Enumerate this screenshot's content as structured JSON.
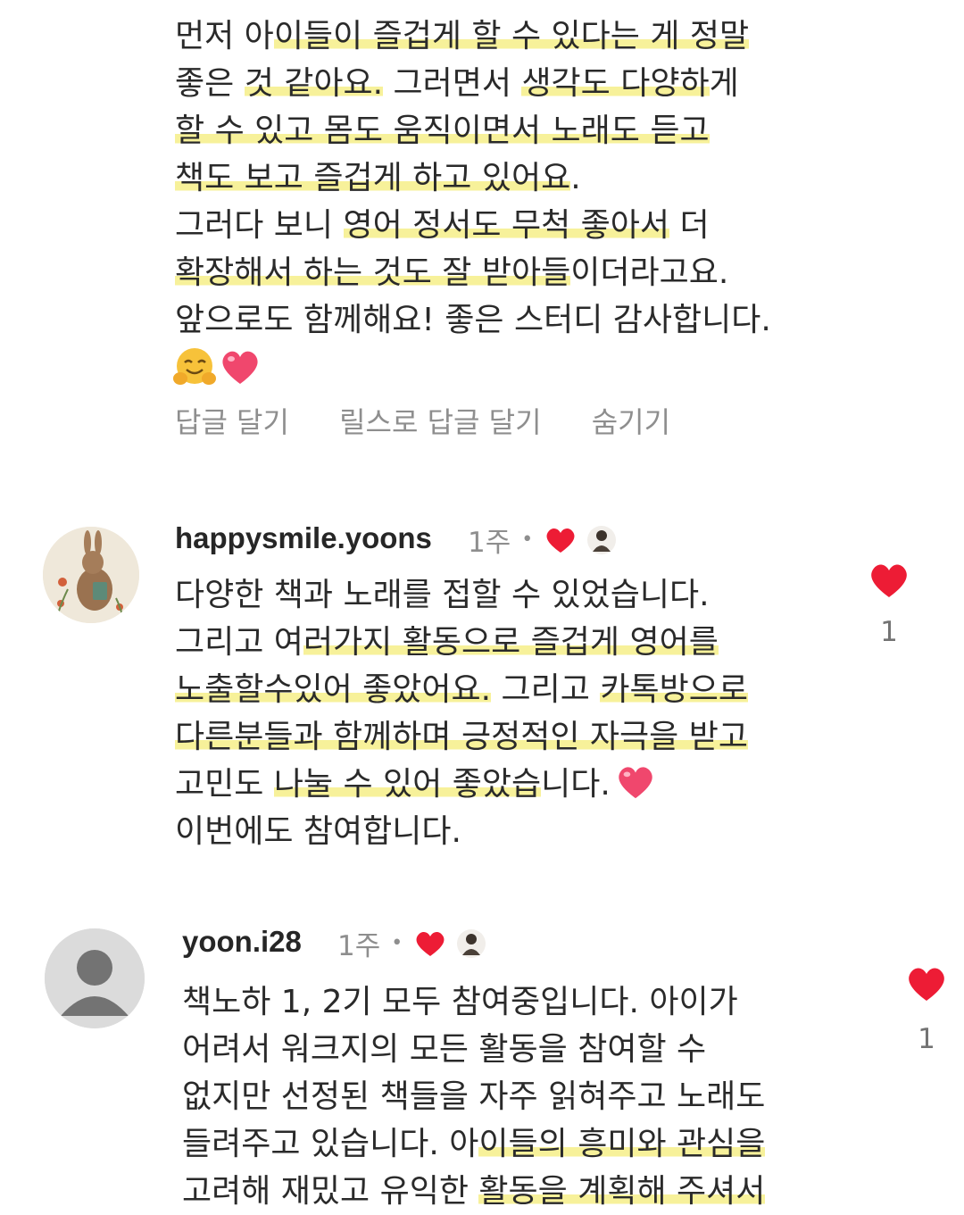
{
  "comment_prev": {
    "lines": [
      [
        "먼저 아",
        "이들이 즐겁게 할 수 있다는 게 정말",
        ""
      ],
      [
        "좋은 ",
        "것 같아요.",
        " 그러면서 ",
        "생각도 다양하",
        "게"
      ],
      [
        "",
        "할 수 있고 몸도 움직이면서 노래도 듣고",
        ""
      ],
      [
        "",
        "책도 보고 즐겁게 하고 있어요",
        "."
      ],
      [
        "그러다 보니 ",
        "영어 정서도 무척 좋아서",
        " 더"
      ],
      [
        "",
        "확장해서 하는 것도 잘 받아들",
        "이더라고요."
      ],
      [
        "앞으로도 함께해요! 좋은 스터디 감사합니다.",
        "",
        ""
      ]
    ],
    "actions": {
      "reply": "답글 달기",
      "reels_reply": "릴스로 답글 달기",
      "hide": "숨기기"
    }
  },
  "comment_1": {
    "username": "happysmile.yoons",
    "time": "1주",
    "like_count": "1",
    "lines": [
      [
        "다양한 책과 노래를 접할 수 있었습니다.",
        "",
        ""
      ],
      [
        "그리고 여",
        "러가지 활동으로 즐겁게 영어를",
        ""
      ],
      [
        "",
        "노출할수있어 좋았어요.",
        " 그리고 ",
        "카톡방으로"
      ],
      [
        "",
        "다른분들과 함께하며 긍정적인 자극을 받고",
        ""
      ],
      [
        "고민도 ",
        "나눌 수 있어 좋았습",
        "니다."
      ],
      [
        "이번에도 참여합니다.",
        "",
        ""
      ]
    ]
  },
  "comment_2": {
    "username": "yoon.i28",
    "time": "1주",
    "like_count": "1",
    "lines": [
      [
        "책노하 1, 2기 모두 참여중입니다. 아이가",
        "",
        ""
      ],
      [
        "어려서 워크지의 모든 활동을 참여할 수",
        "",
        ""
      ],
      [
        "없지만 선정된 책들을 자주 읽혀주고 노래도",
        "",
        ""
      ],
      [
        "들려주고 있습니다. 아",
        "이들의 흥미와 관심을",
        ""
      ],
      [
        "고려해 재밌고 유익한 ",
        "활동을 계획해 주셔서",
        ""
      ]
    ]
  },
  "colors": {
    "heart": "#ed1c35",
    "highlight": "#f4ec78",
    "muted": "#8e8e8e"
  },
  "icons": {
    "like": "heart-icon",
    "creator_liked": "creator-avatar-icon",
    "default_avatar": "person-icon"
  }
}
